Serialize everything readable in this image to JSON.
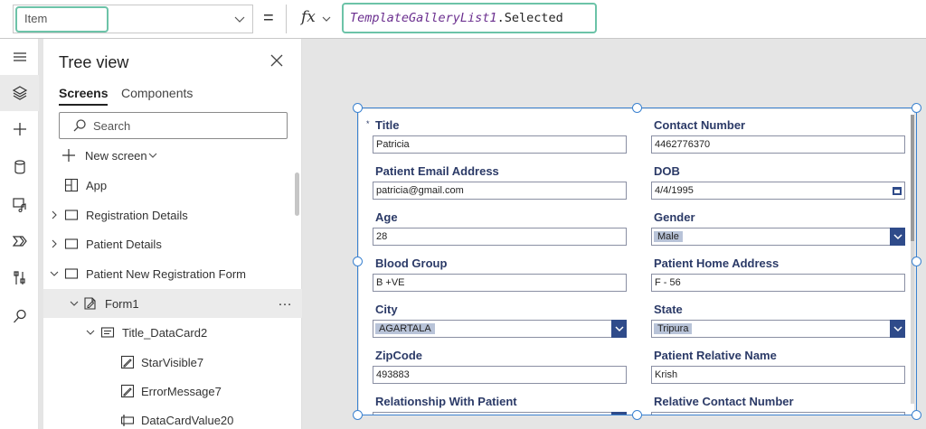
{
  "formula_bar": {
    "property": "Item",
    "equals": "=",
    "fx": "fx",
    "formula_ref": "TemplateGalleryList1",
    "formula_prop": ".Selected"
  },
  "rail": {
    "icons": [
      "hamburger-icon",
      "layers-icon",
      "plus-icon",
      "database-icon",
      "media-icon",
      "power-automate-icon",
      "tools-icon",
      "search-icon"
    ],
    "active": "layers-icon"
  },
  "tree": {
    "title": "Tree view",
    "tabs": {
      "screens": "Screens",
      "components": "Components"
    },
    "search_placeholder": "Search",
    "new_screen": "New screen",
    "items": [
      {
        "label": "App"
      },
      {
        "label": "Registration Details"
      },
      {
        "label": "Patient Details"
      },
      {
        "label": "Patient New Registration Form"
      },
      {
        "label": "Form1",
        "more": "…"
      },
      {
        "label": "Title_DataCard2"
      },
      {
        "label": "StarVisible7"
      },
      {
        "label": "ErrorMessage7"
      },
      {
        "label": "DataCardValue20"
      }
    ]
  },
  "form": {
    "required_marker": "*",
    "cards": [
      {
        "label": "Title",
        "value": "Patricia",
        "required": true
      },
      {
        "label": "Contact Number",
        "value": "4462776370"
      },
      {
        "label": "Patient Email Address",
        "value": "patricia@gmail.com"
      },
      {
        "label": "DOB",
        "value": "4/4/1995",
        "type": "date"
      },
      {
        "label": "Age",
        "value": "28"
      },
      {
        "label": "Gender",
        "value": "Male",
        "type": "dropdown"
      },
      {
        "label": "Blood Group",
        "value": "B +VE"
      },
      {
        "label": "Patient Home Address",
        "value": "F - 56"
      },
      {
        "label": "City",
        "value": "AGARTALA",
        "type": "dropdown"
      },
      {
        "label": "State",
        "value": "Tripura",
        "type": "dropdown"
      },
      {
        "label": "ZipCode",
        "value": "493883"
      },
      {
        "label": "Patient Relative Name",
        "value": "Krish"
      },
      {
        "label": "Relationship With Patient",
        "value": "",
        "type": "dropdown"
      },
      {
        "label": "Relative Contact Number",
        "value": ""
      }
    ]
  },
  "colors": {
    "accent_green": "#6cc3a8",
    "selection_blue": "#3b82d0",
    "label_navy": "#2b3a67",
    "dropdown_navy": "#2f4b8a"
  }
}
